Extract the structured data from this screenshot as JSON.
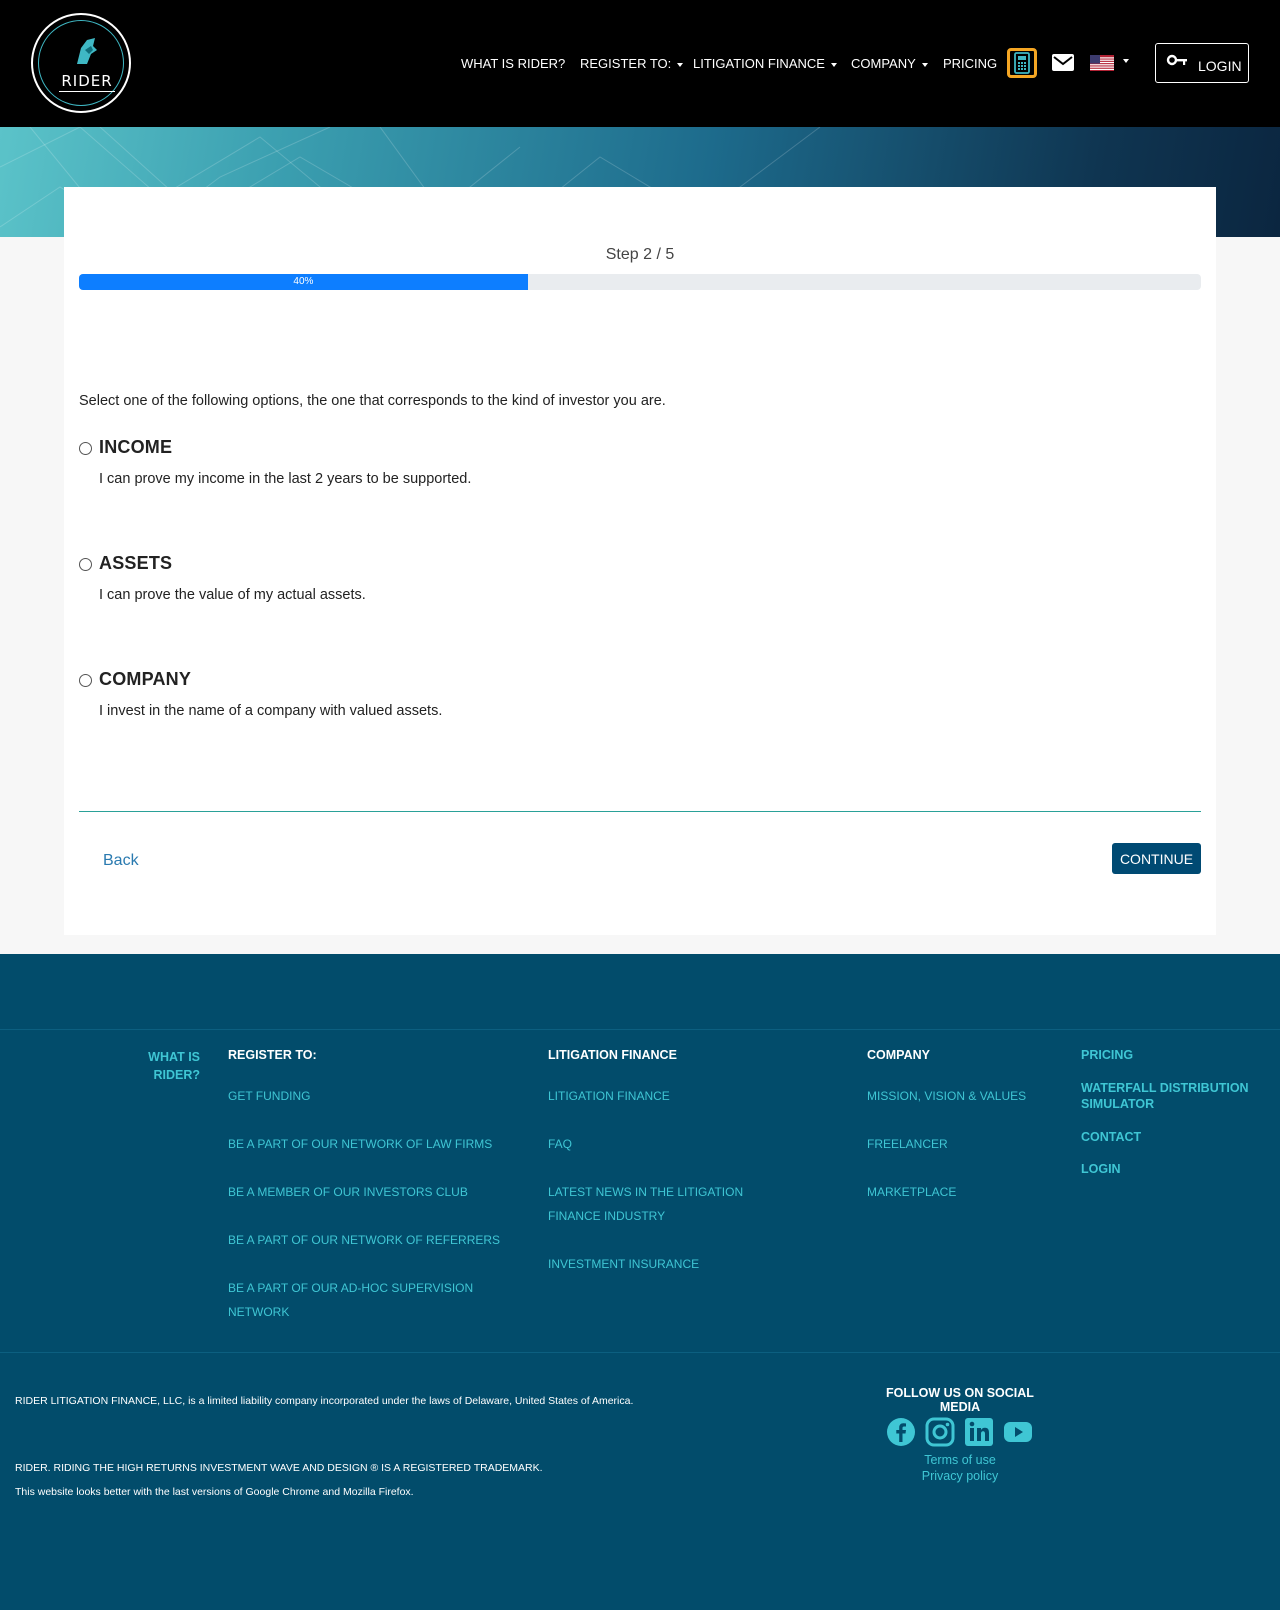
{
  "header": {
    "logo_text": "RIDER",
    "nav": [
      {
        "label": "WHAT IS RIDER?"
      },
      {
        "label": "REGISTER TO:"
      },
      {
        "label": "LITIGATION FINANCE"
      },
      {
        "label": "COMPANY"
      },
      {
        "label": "PRICING"
      }
    ],
    "login_label": "LOGIN",
    "icons": [
      "calculator-icon",
      "mail-icon",
      "us-flag-icon",
      "key-icon"
    ]
  },
  "wizard": {
    "step_label": "Step 2 / 5",
    "progress_label": "40%",
    "progress_fraction": 0.4,
    "intro": "Select one of the following options, the one that corresponds to the kind of investor you are.",
    "options": [
      {
        "title": "INCOME",
        "description": "I can prove my income in the last 2 years to be supported."
      },
      {
        "title": "ASSETS",
        "description": "I can prove the value of my actual assets."
      },
      {
        "title": "COMPANY",
        "description": "I invest in the name of a company with valued assets."
      }
    ],
    "back_label": "Back",
    "continue_label": "CONTINUE"
  },
  "footer": {
    "what_is_rider": "WHAT IS RIDER?",
    "register": {
      "title": "REGISTER TO:",
      "links": [
        "GET FUNDING",
        "BE A PART OF OUR NETWORK OF LAW FIRMS",
        "BE A MEMBER OF OUR INVESTORS CLUB",
        "BE A PART OF OUR NETWORK OF REFERRERS",
        "BE A PART OF OUR AD-HOC SUPERVISION NETWORK"
      ]
    },
    "litigation": {
      "title": "LITIGATION FINANCE",
      "links": [
        "LITIGATION FINANCE",
        "FAQ",
        "LATEST NEWS IN THE LITIGATION FINANCE INDUSTRY",
        "INVESTMENT INSURANCE"
      ]
    },
    "company": {
      "title": "COMPANY",
      "links": [
        "MISSION, VISION & VALUES",
        "FREELANCER",
        "MARKETPLACE"
      ]
    },
    "extra": [
      "PRICING",
      "WATERFALL DISTRIBUTION SIMULATOR",
      "CONTACT",
      "LOGIN"
    ],
    "legal_1": "RIDER LITIGATION FINANCE, LLC, is a limited liability company incorporated under the laws of Delaware, United States of America.",
    "legal_2": "RIDER. RIDING THE HIGH RETURNS INVESTMENT WAVE AND DESIGN ® IS A REGISTERED TRADEMARK.",
    "legal_3": "This website looks better with the last versions of Google Chrome and Mozilla Firefox.",
    "follow": "FOLLOW US ON SOCIAL MEDIA",
    "social_icons": [
      "facebook-icon",
      "instagram-icon",
      "linkedin-icon",
      "youtube-icon"
    ],
    "terms": "Terms of use",
    "privacy": "Privacy policy"
  },
  "colors": {
    "header_bg": "#000000",
    "accent_blue": "#0d7eff",
    "button_navy": "#004a73",
    "footer_bg": "#024c6b",
    "footer_link": "#3fc6d4",
    "calc_border": "#f5a623"
  }
}
